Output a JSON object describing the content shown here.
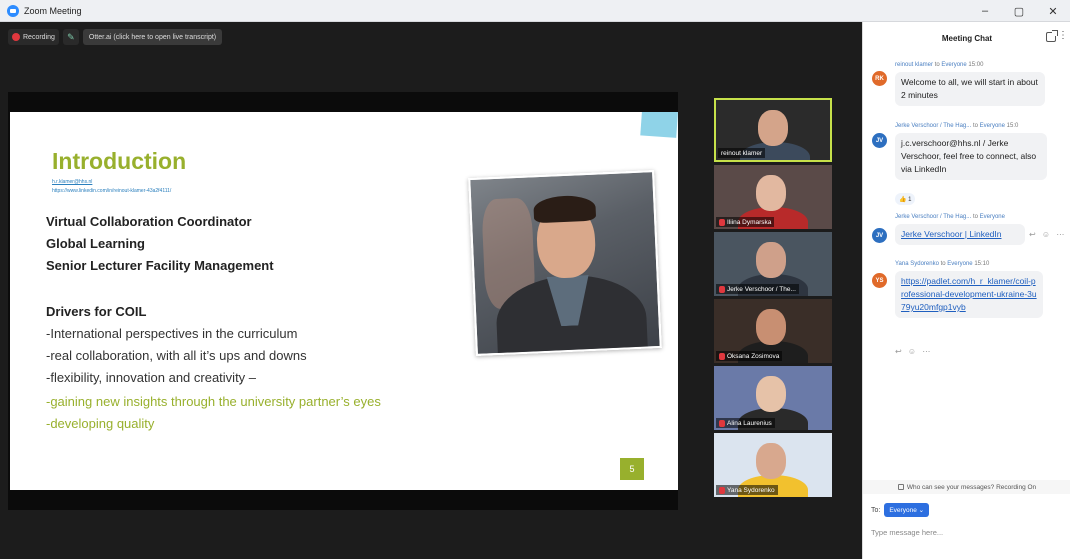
{
  "window": {
    "title": "Zoom Meeting",
    "controls": [
      "–",
      "▢",
      "✕"
    ]
  },
  "toolbar": {
    "recording_label": "Recording",
    "otter_label": "Otter.ai (click here to open live transcript)"
  },
  "slide": {
    "title": "Introduction",
    "link_email": "h.r.klamer@hhs.nl",
    "link_linkedin": "https://www.linkedin.com/in/reinout-klamer-43a2f4111/",
    "roles": [
      "Virtual Collaboration Coordinator",
      "Global Learning",
      "Senior Lecturer Facility Management"
    ],
    "drivers_title": "Drivers for COIL",
    "drivers": [
      "-International perspectives in the curriculum",
      "-real collaboration, with all it’s ups and downs",
      "-flexibility, innovation and creativity –",
      "-gaining new insights through the university partner’s eyes",
      "-developing quality"
    ],
    "page_number": "5",
    "accent_color": "#98b02d"
  },
  "participants": [
    {
      "name": "reinout klamer",
      "muted": false,
      "active": true
    },
    {
      "name": "Iliina Dymarska",
      "muted": true,
      "active": false
    },
    {
      "name": "Jerke Verschoor / The...",
      "muted": true,
      "active": false
    },
    {
      "name": "Oksana Zosimova",
      "muted": true,
      "active": false
    },
    {
      "name": "Alina Laurenius",
      "muted": true,
      "active": false
    },
    {
      "name": "Yana Sydorenko",
      "muted": true,
      "active": false
    }
  ],
  "chat": {
    "title": "Meeting Chat",
    "messages": [
      {
        "initials": "RK",
        "avatar_color": "#e06a2a",
        "sender": "reinout klamer",
        "to_label": "to",
        "recipient": "Everyone",
        "time": "15:00",
        "text": "Welcome to all, we will start in about 2 minutes"
      },
      {
        "initials": "JV",
        "avatar_color": "#2d6fc0",
        "sender": "Jerke Verschoor / The Hag...",
        "to_label": "to",
        "recipient": "Everyone",
        "time": "15:0",
        "text": "j.c.verschoor@hhs.nl / Jerke Verschoor, feel free to connect, also via LinkedIn",
        "reaction": "👍 1"
      },
      {
        "initials": "JV",
        "avatar_color": "#2d6fc0",
        "sender": "Jerke Verschoor / The Hag...",
        "to_label": "to",
        "recipient": "Everyone",
        "time": "",
        "text": "Jerke Verschoor | LinkedIn"
      },
      {
        "initials": "YS",
        "avatar_color": "#e06a2a",
        "sender": "Yana Sydorenko",
        "to_label": "to",
        "recipient": "Everyone",
        "time": "15:10",
        "text": "https://padlet.com/h_r_klamer/coil-professional-development-ukraine-3u79yu20mfgp1vyb"
      }
    ],
    "visibility_note": "Who can see your messages? Recording On",
    "to_label": "To:",
    "recipient_button": "Everyone ⌄",
    "input_placeholder": "Type message here..."
  }
}
